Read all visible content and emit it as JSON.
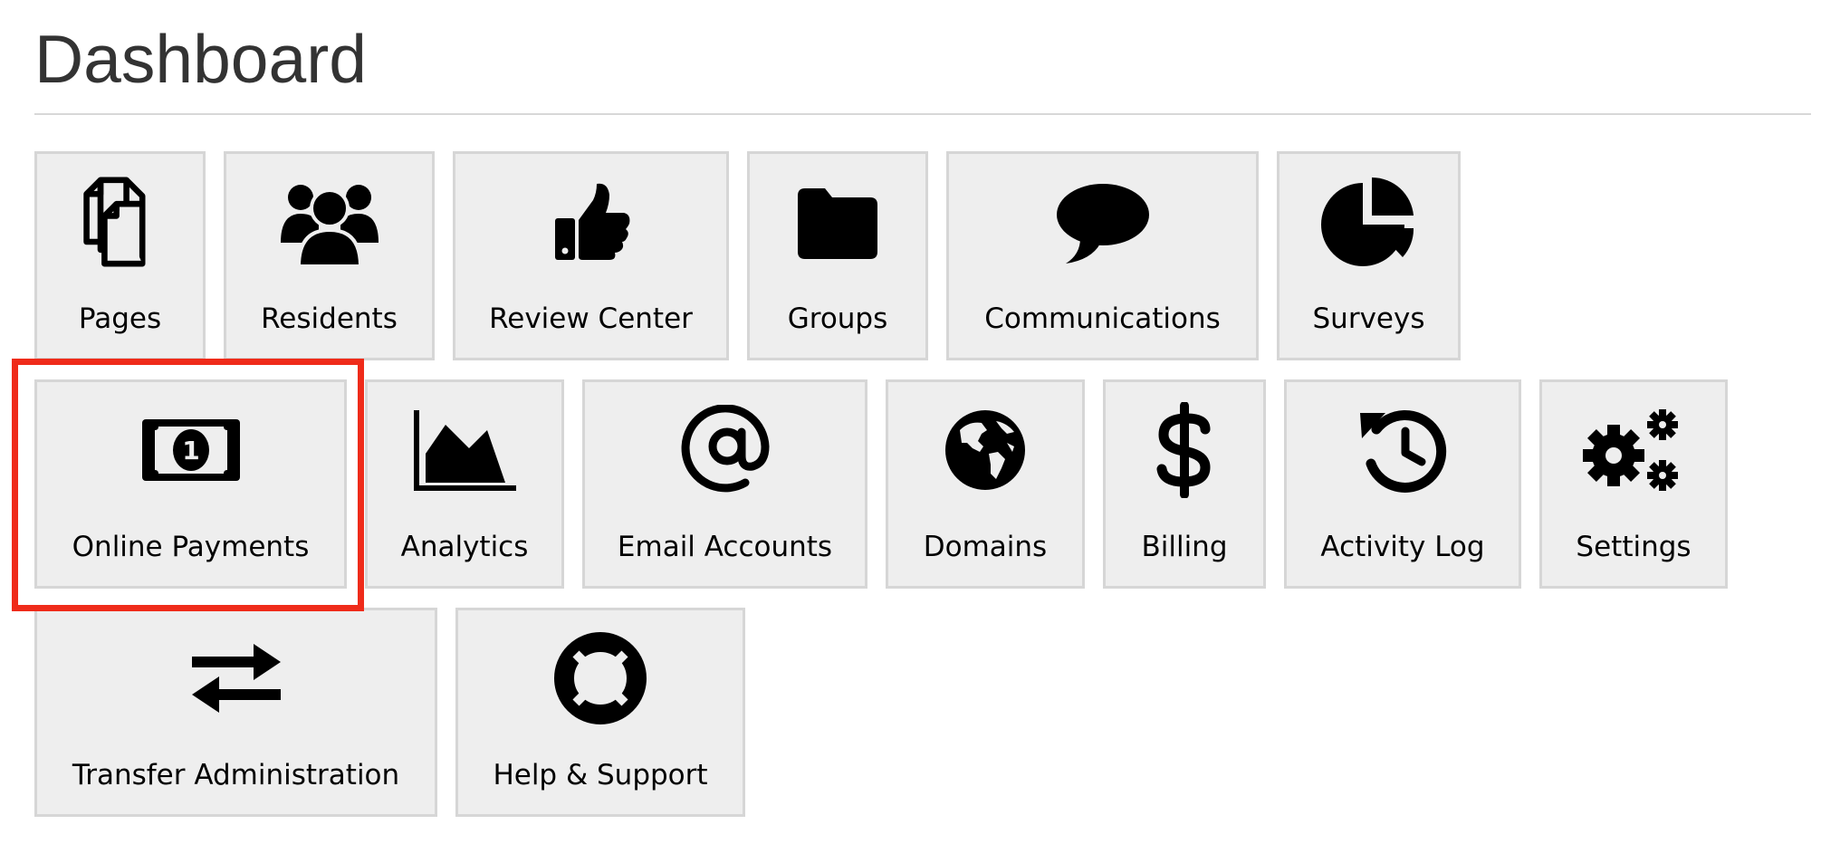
{
  "header": {
    "title": "Dashboard"
  },
  "tiles": {
    "pages": {
      "label": "Pages",
      "icon": "pages-icon"
    },
    "residents": {
      "label": "Residents",
      "icon": "users-icon"
    },
    "review_center": {
      "label": "Review Center",
      "icon": "thumbs-up-icon"
    },
    "groups": {
      "label": "Groups",
      "icon": "folder-icon"
    },
    "communications": {
      "label": "Communications",
      "icon": "speech-bubble-icon"
    },
    "surveys": {
      "label": "Surveys",
      "icon": "pie-chart-icon"
    },
    "online_payments": {
      "label": "Online Payments",
      "icon": "money-bill-icon"
    },
    "analytics": {
      "label": "Analytics",
      "icon": "area-chart-icon"
    },
    "email_accounts": {
      "label": "Email Accounts",
      "icon": "at-sign-icon"
    },
    "domains": {
      "label": "Domains",
      "icon": "globe-icon"
    },
    "billing": {
      "label": "Billing",
      "icon": "dollar-icon"
    },
    "activity_log": {
      "label": "Activity Log",
      "icon": "history-icon"
    },
    "settings": {
      "label": "Settings",
      "icon": "gears-icon"
    },
    "transfer_administration": {
      "label": "Transfer Administration",
      "icon": "exchange-icon"
    },
    "help_support": {
      "label": "Help & Support",
      "icon": "life-ring-icon"
    }
  },
  "highlight": {
    "target": "online_payments",
    "color": "#ef2b1a"
  },
  "colors": {
    "tile_background": "#eeeeee",
    "tile_border": "#d6d6d6",
    "title": "#333333",
    "icon": "#000000"
  }
}
